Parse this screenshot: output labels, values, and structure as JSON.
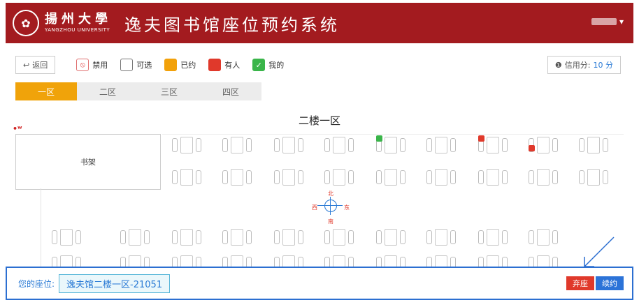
{
  "header": {
    "university_cn": "揚州大學",
    "university_en": "YANGZHOU UNIVERSITY",
    "system_title": "逸夫图书馆座位预约系统"
  },
  "toolbar": {
    "back_label": "返回",
    "legend": [
      {
        "label": "禁用",
        "kind": "disabled"
      },
      {
        "label": "可选",
        "kind": "free"
      },
      {
        "label": "已约",
        "kind": "booked"
      },
      {
        "label": "有人",
        "kind": "taken"
      },
      {
        "label": "我的",
        "kind": "mine"
      }
    ],
    "credit_label": "信用分:",
    "credit_value": "10 分"
  },
  "tabs": [
    "一区",
    "二区",
    "三区",
    "四区"
  ],
  "active_tab": 0,
  "hall": {
    "title": "二楼一区",
    "shelf_label": "书架",
    "compass": {
      "north": "北",
      "south": "南",
      "west": "西",
      "east": "东"
    }
  },
  "bottom": {
    "my_seat_label": "您的座位:",
    "my_seat_value": "逸夫馆二楼一区-21051",
    "abandon_label": "弃座",
    "renew_label": "续约"
  },
  "colors": {
    "header": "#a31b1f",
    "booked": "#f2a10a",
    "taken": "#e0392b",
    "mine": "#3ab54a",
    "accent": "#2c73d8"
  }
}
